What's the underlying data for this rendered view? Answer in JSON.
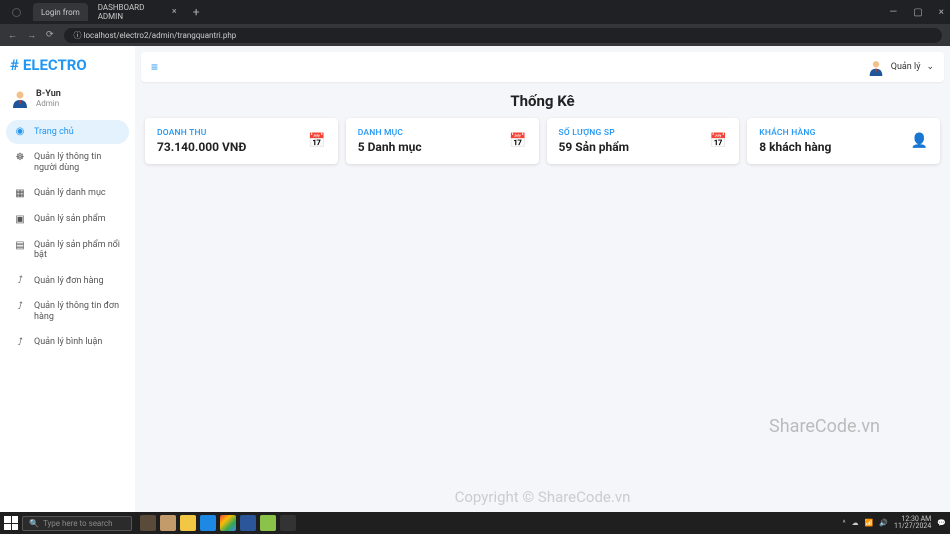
{
  "browser": {
    "tabs": [
      {
        "title": "Login from"
      },
      {
        "title": "DASHBOARD ADMIN"
      }
    ],
    "url": "localhost/electro2/admin/trangquantri.php"
  },
  "brand": "ELECTRO",
  "user": {
    "name": "B-Yun",
    "role": "Admin"
  },
  "sidebar": {
    "items": [
      {
        "icon": "dashboard-icon",
        "label": "Trang chủ",
        "active": true
      },
      {
        "icon": "users-icon",
        "label": "Quản lý thông tin người dùng"
      },
      {
        "icon": "grid-icon",
        "label": "Quản lý danh mục"
      },
      {
        "icon": "box-icon",
        "label": "Quản lý sản phẩm"
      },
      {
        "icon": "star-box-icon",
        "label": "Quản lý sản phẩm nổi bật"
      },
      {
        "icon": "chart-icon",
        "label": "Quản lý đơn hàng"
      },
      {
        "icon": "chart-icon",
        "label": "Quản lý thông tin đơn hàng"
      },
      {
        "icon": "chart-icon",
        "label": "Quản lý bình luận"
      }
    ]
  },
  "topbar": {
    "dropdown": "Quản lý"
  },
  "page_title": "Thống Kê",
  "cards": [
    {
      "label": "DOANH THU",
      "value": "73.140.000 VNĐ",
      "icon": "calendar-icon"
    },
    {
      "label": "DANH MỤC",
      "value": "5 Danh mục",
      "icon": "calendar-icon"
    },
    {
      "label": "SỐ LƯỢNG SP",
      "value": "59 Sản phẩm",
      "icon": "calendar-icon"
    },
    {
      "label": "KHÁCH HÀNG",
      "value": "8 khách hàng",
      "icon": "user-icon"
    }
  ],
  "watermarks": {
    "mid": "ShareCode.vn",
    "bottom": "Copyright © ShareCode.vn",
    "logo_a": "S",
    "logo_b": "HARECODE",
    "logo_c": ".vn"
  },
  "taskbar": {
    "search_placeholder": "Type here to search",
    "time": "12:30 AM",
    "date": "11/27/2024"
  }
}
